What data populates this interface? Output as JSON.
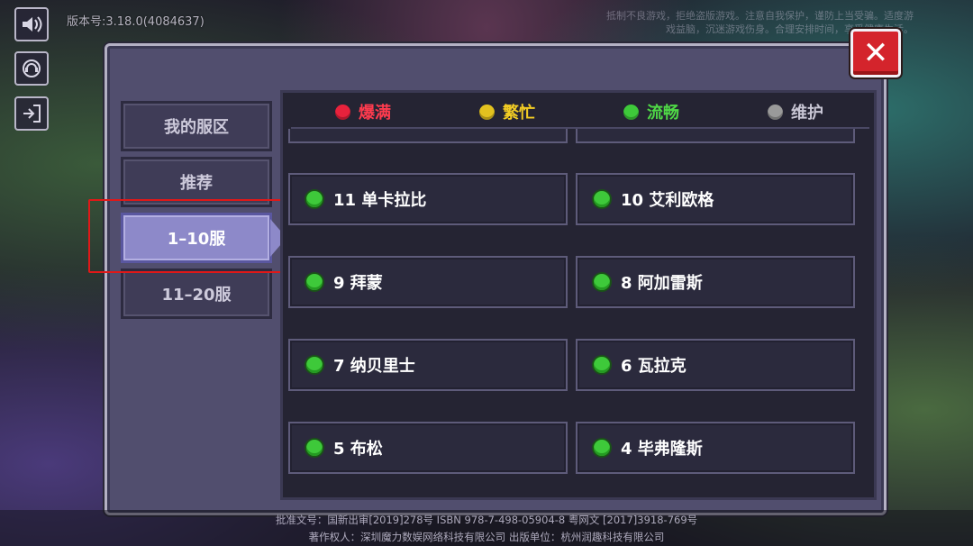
{
  "version_text": "版本号:3.18.0(4084637)",
  "notice_text": "抵制不良游戏，拒绝盗版游戏。注意自我保护，谨防上当受骗。适度游戏益脑，沉迷游戏伤身。合理安排时间，享受健康生活。",
  "footer": {
    "line1": "批准文号：国新出审[2019]278号 ISBN 978-7-498-05904-8 粤网文 [2017]3918-769号",
    "line2": "著作权人：深圳魔力数娱网络科技有限公司 出版单位：杭州润趣科技有限公司"
  },
  "side_icons": [
    "speaker-icon",
    "customer-service-icon",
    "logout-icon"
  ],
  "close_label": "✕",
  "tabs": [
    {
      "label": "我的服区",
      "active": false
    },
    {
      "label": "推荐",
      "active": false
    },
    {
      "label": "1–10服",
      "active": true
    },
    {
      "label": "11–20服",
      "active": false
    }
  ],
  "legend": [
    {
      "label": "爆满",
      "color": "#e8223c",
      "text_color": "#ff3b4e"
    },
    {
      "label": "繁忙",
      "color": "#e3c21f",
      "text_color": "#f2cc24"
    },
    {
      "label": "流畅",
      "color": "#3ec93a",
      "text_color": "#4fd846"
    },
    {
      "label": "维护",
      "color": "#9a9a9a",
      "text_color": "#c8c6d4"
    }
  ],
  "servers": [
    {
      "label": "11 单卡拉比",
      "status": "流畅"
    },
    {
      "label": "10 艾利欧格",
      "status": "流畅"
    },
    {
      "label": "9 拜蒙",
      "status": "流畅"
    },
    {
      "label": "8 阿加雷斯",
      "status": "流畅"
    },
    {
      "label": "7 纳贝里士",
      "status": "流畅"
    },
    {
      "label": "6 瓦拉克",
      "status": "流畅"
    },
    {
      "label": "5 布松",
      "status": "流畅"
    },
    {
      "label": "4 毕弗隆斯",
      "status": "流畅"
    }
  ]
}
